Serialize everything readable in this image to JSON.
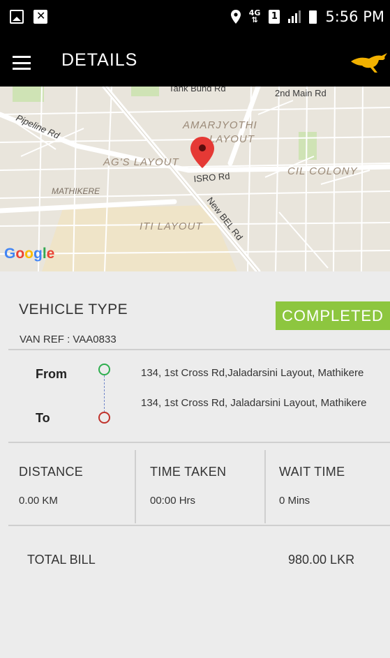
{
  "status_bar": {
    "network": "4G",
    "sim": "1",
    "time": "5:56 PM"
  },
  "app_bar": {
    "title": "DETAILS"
  },
  "map": {
    "labels": {
      "tank_bund": "Tank Bund Rd",
      "second_main": "2nd Main Rd",
      "amarjyothi": "AMARJYOTHI",
      "layout": "LAYOUT",
      "pipeline": "Pipeline Rd",
      "ags_layout": "AG'S LAYOUT",
      "isro": "ISRO Rd",
      "cil_colony": "CIL COLONY",
      "mathikere": "MATHIKERE",
      "new_bel": "New BEL Rd",
      "iti_layout": "ITI LAYOUT",
      "google": "Google"
    },
    "google_colors": [
      "#4285f4",
      "#ea4335",
      "#fbbc05",
      "#4285f4",
      "#34a853",
      "#ea4335"
    ]
  },
  "trip": {
    "vehicle_type": "VEHICLE TYPE",
    "status": "COMPLETED",
    "van_ref": "VAN  REF : VAA0833",
    "from_label": "From",
    "from_address": "134, 1st Cross Rd,Jaladarsini Layout, Mathikere",
    "to_label": "To",
    "to_address": "134, 1st Cross Rd, Jaladarsini Layout, Mathikere"
  },
  "stats": {
    "distance_label": "DISTANCE",
    "distance_value": "0.00 KM",
    "time_label": "TIME TAKEN",
    "time_value": "00:00 Hrs",
    "wait_label": "WAIT TIME",
    "wait_value": "0 Mins"
  },
  "bill": {
    "label": "TOTAL BILL",
    "value": "980.00 LKR"
  },
  "colors": {
    "status_green": "#8dc63f",
    "from_circle": "#2eae4e",
    "to_circle": "#c0322b",
    "pin": "#e53935"
  }
}
